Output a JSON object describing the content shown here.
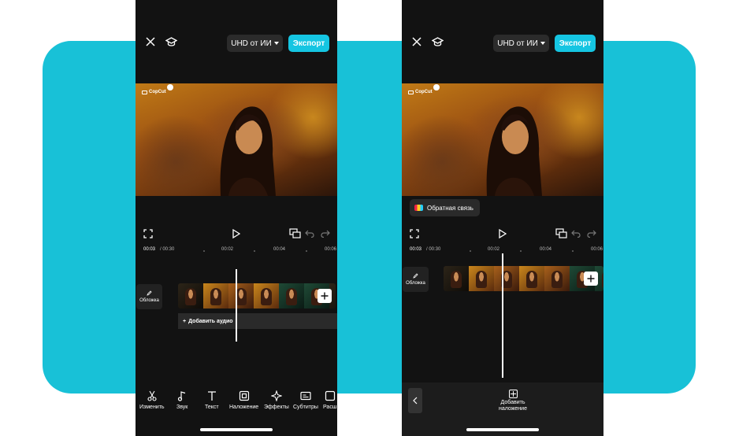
{
  "brand_colors": {
    "accent": "#18c1d7",
    "export_button": "#15c5e2",
    "phone_bg": "#121212"
  },
  "icons": {
    "close": "close-icon",
    "learn": "graduation-cap-icon",
    "fullscreen": "fullscreen-icon",
    "play": "play-icon",
    "compare": "compare-toggle-icon",
    "undo": "undo-icon",
    "redo": "redo-icon",
    "edit": "pencil-icon",
    "add": "plus-icon",
    "back": "chevron-left-icon"
  },
  "editor_a": {
    "header": {
      "quality_label": "UHD от ИИ",
      "export_label": "Экспорт"
    },
    "watermark": "CopCut",
    "timecode": {
      "current": "00:03",
      "total": "/ 00:30"
    },
    "ruler_ticks": [
      "00:02",
      "00:04",
      "00:06"
    ],
    "cover_label": "Обложка",
    "add_audio_label": "Добавить аудио",
    "toolbar": [
      {
        "label": "Изменить",
        "icon": "scissors-icon"
      },
      {
        "label": "Звук",
        "icon": "music-note-icon"
      },
      {
        "label": "Текст",
        "icon": "text-icon"
      },
      {
        "label": "Наложение",
        "icon": "overlay-icon"
      },
      {
        "label": "Эффекты",
        "icon": "sparkle-icon"
      },
      {
        "label": "Субтитры",
        "icon": "captions-icon"
      },
      {
        "label": "Расш",
        "icon": "expand-icon"
      }
    ]
  },
  "editor_b": {
    "header": {
      "quality_label": "UHD от ИИ",
      "export_label": "Экспорт"
    },
    "watermark": "CopCut",
    "feedback_label": "Обратная связь",
    "timecode": {
      "current": "00:03",
      "total": "/ 00:30"
    },
    "ruler_ticks": [
      "00:02",
      "00:04",
      "00:06"
    ],
    "cover_label": "Обложка",
    "add_overlay_label": "Добавить наложение"
  }
}
